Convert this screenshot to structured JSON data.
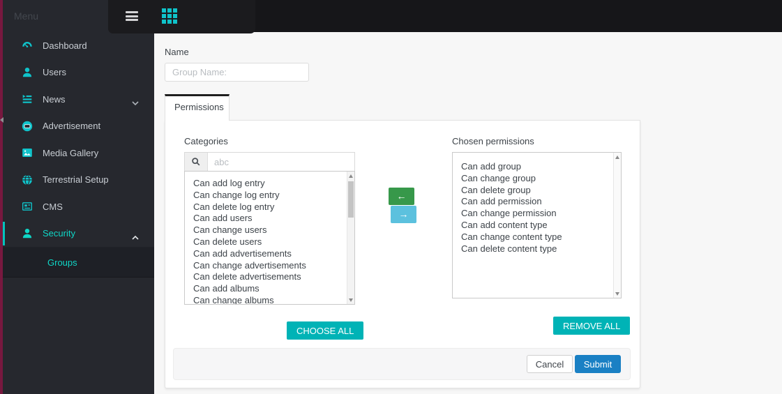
{
  "topbar": {
    "menu_label": "Menu"
  },
  "sidebar": {
    "items": [
      {
        "label": "Dashboard",
        "icon": "gauge-icon"
      },
      {
        "label": "Users",
        "icon": "user-icon"
      },
      {
        "label": "News",
        "icon": "news-list-icon",
        "chevron": "down"
      },
      {
        "label": "Advertisement",
        "icon": "advertisement-icon"
      },
      {
        "label": "Media Gallery",
        "icon": "image-icon"
      },
      {
        "label": "Terrestrial Setup",
        "icon": "globe-icon"
      },
      {
        "label": "CMS",
        "icon": "newspaper-icon"
      },
      {
        "label": "Security",
        "icon": "user-icon",
        "chevron": "up",
        "active": true
      }
    ],
    "submenu": [
      {
        "label": "Groups",
        "active": true
      }
    ]
  },
  "form": {
    "name_label": "Name",
    "name_placeholder": "Group Name:",
    "tab_label": "Permissions",
    "categories_label": "Categories",
    "search_placeholder": "abc",
    "categories": [
      "Can add log entry",
      "Can change log entry",
      "Can delete log entry",
      "Can add users",
      "Can change users",
      "Can delete users",
      "Can add advertisements",
      "Can change advertisements",
      "Can delete advertisements",
      "Can add albums",
      "Can change albums"
    ],
    "chosen_label": "Chosen permissions",
    "chosen": [
      "Can add group",
      "Can change group",
      "Can delete group",
      "Can add permission",
      "Can change permission",
      "Can add content type",
      "Can change content type",
      "Can delete content type"
    ],
    "choose_all": "CHOOSE ALL",
    "remove_all": "REMOVE ALL",
    "cancel": "Cancel",
    "submit": "Submit"
  },
  "icons": {
    "arrow_left": "←",
    "arrow_right": "→"
  },
  "colors": {
    "teal_accent": "#00b3b6",
    "teal_icon": "#0fc3ca",
    "active_text": "#0fd6c6",
    "green_move": "#37984a",
    "blue_move": "#5cc1de",
    "submit_blue": "#1a80c4",
    "maroon_stripe": "#77183f",
    "sidebar_bg": "#26282e",
    "topbar_bg": "#161619"
  }
}
